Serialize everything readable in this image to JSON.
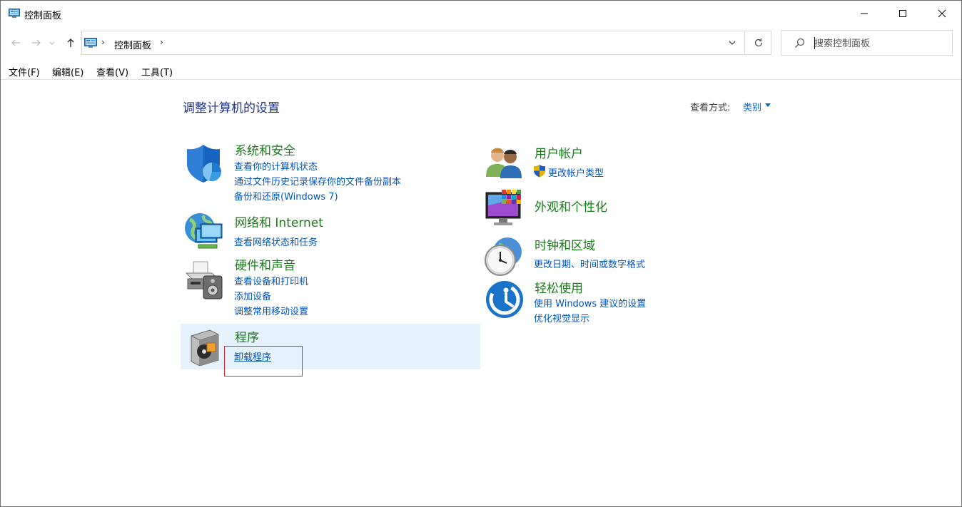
{
  "window": {
    "title": "控制面板",
    "minimize_icon": "minimize-icon",
    "maximize_icon": "maximize-icon",
    "close_icon": "close-icon"
  },
  "address": {
    "crumb": "控制面板"
  },
  "search": {
    "placeholder": "搜索控制面板"
  },
  "menu": [
    "文件(F)",
    "编辑(E)",
    "查看(V)",
    "工具(T)"
  ],
  "main": {
    "heading": "调整计算机的设置",
    "view_by_label": "查看方式:",
    "view_by_value": "类别"
  },
  "categories": {
    "system": {
      "title": "系统和安全",
      "links": [
        "查看你的计算机状态",
        "通过文件历史记录保存你的文件备份副本",
        "备份和还原(Windows 7)"
      ]
    },
    "network": {
      "title": "网络和 Internet",
      "links": [
        "查看网络状态和任务"
      ]
    },
    "hardware": {
      "title": "硬件和声音",
      "links": [
        "查看设备和打印机",
        "添加设备",
        "调整常用移动设置"
      ]
    },
    "programs": {
      "title": "程序",
      "links": [
        "卸载程序"
      ]
    },
    "users": {
      "title": "用户帐户",
      "links": [
        "更改帐户类型"
      ]
    },
    "appearance": {
      "title": "外观和个性化"
    },
    "clock": {
      "title": "时钟和区域",
      "links": [
        "更改日期、时间或数字格式"
      ]
    },
    "ease": {
      "title": "轻松使用",
      "links": [
        "使用 Windows 建议的设置",
        "优化视觉显示"
      ]
    }
  },
  "colors": {
    "category_title": "#1c7b1c",
    "link": "#0055bb",
    "heading": "#1e3287",
    "highlight": "#e5f1fb",
    "annotation_box": "#e0262b"
  }
}
